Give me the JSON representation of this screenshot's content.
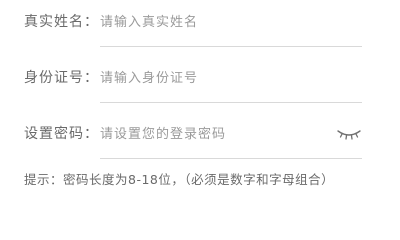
{
  "form": {
    "fields": [
      {
        "label": "真实姓名：",
        "placeholder": "请输入真实姓名",
        "value": ""
      },
      {
        "label": "身份证号：",
        "placeholder": "请输入身份证号",
        "value": ""
      },
      {
        "label": "设置密码：",
        "placeholder": "请设置您的登录密码",
        "value": "",
        "icon": "eye-closed-icon"
      }
    ],
    "hint": "提示：密码长度为8-18位，（必须是数字和字母组合）"
  },
  "colors": {
    "text": "#6a6a6a",
    "placeholder": "#9a9a9a",
    "divider": "#d9d9d9",
    "background": "#ffffff"
  }
}
